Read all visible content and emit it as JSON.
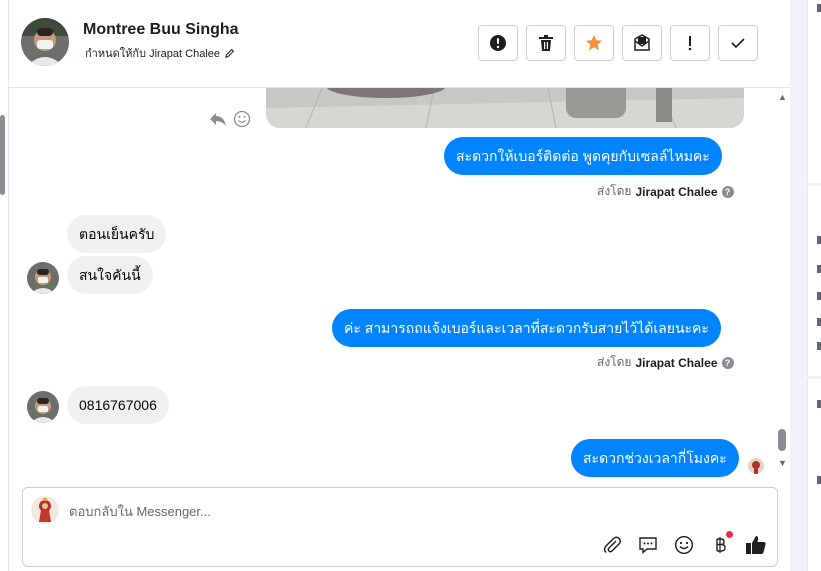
{
  "header": {
    "contact_name": "Montree Buu Singha",
    "assigned_to_text": "กำหนดให้กับ Jirapat Chalee"
  },
  "actions": [
    {
      "name": "spam-button",
      "icon": "exclamation-circle-icon"
    },
    {
      "name": "delete-button",
      "icon": "trash-icon"
    },
    {
      "name": "star-button",
      "icon": "star-icon",
      "color": "#f7923b"
    },
    {
      "name": "mark-unread-button",
      "icon": "envelope-icon"
    },
    {
      "name": "follow-up-button",
      "icon": "exclamation-icon"
    },
    {
      "name": "done-button",
      "icon": "check-icon"
    }
  ],
  "messages": {
    "m1": "สะดวกให้เบอร์ติดต่อ พูดคุยกับเซลล์ไหมคะ",
    "m1_sent_by_label": "ส่งโดย",
    "m1_sent_by_name": "Jirapat Chalee",
    "m2": "ตอนเย็นครับ",
    "m3": "สนใจคันนี้",
    "m4": "ค่ะ สามารถถแจ้งเบอร์และเวลาที่สะดวกรับสายไว้ได้เลยนะคะ",
    "m4_sent_by_label": "ส่งโดย",
    "m4_sent_by_name": "Jirapat Chalee",
    "m5": "0816767006",
    "m6": "สะดวกช่วงเวลากี่โมงคะ"
  },
  "composer": {
    "placeholder": "ตอบกลับใน Messenger...",
    "value": ""
  },
  "colors": {
    "outgoing_bubble": "#0084ff",
    "incoming_bubble": "#f0f0f0",
    "star": "#f7923b",
    "notification_dot": "#f02849"
  }
}
